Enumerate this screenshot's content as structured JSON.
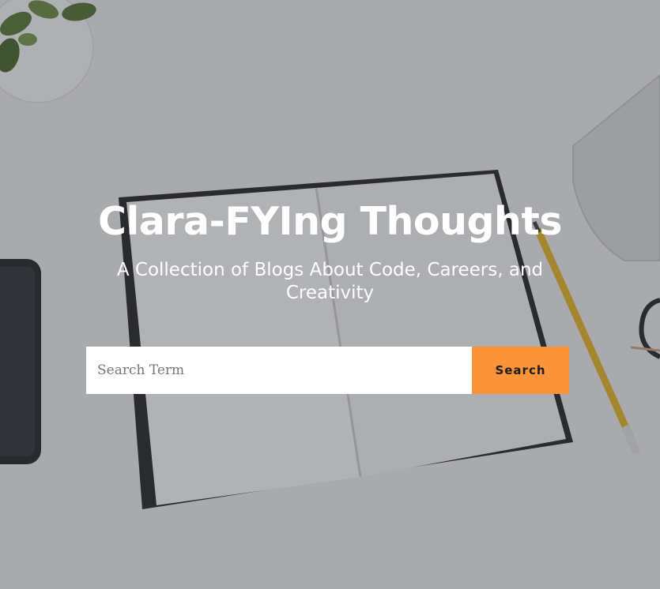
{
  "hero": {
    "title": "Clara-FYIng Thoughts",
    "subtitle": "A Collection of Blogs About Code, Careers, and Creativity"
  },
  "search": {
    "placeholder": "Search Term",
    "value": "",
    "button_label": "Search"
  },
  "colors": {
    "accent": "#fb9439",
    "overlay": "#282a34",
    "text": "#ffffff"
  },
  "background": {
    "scene": [
      "notebook",
      "pencil",
      "plant",
      "phone",
      "laptop",
      "glasses"
    ]
  }
}
